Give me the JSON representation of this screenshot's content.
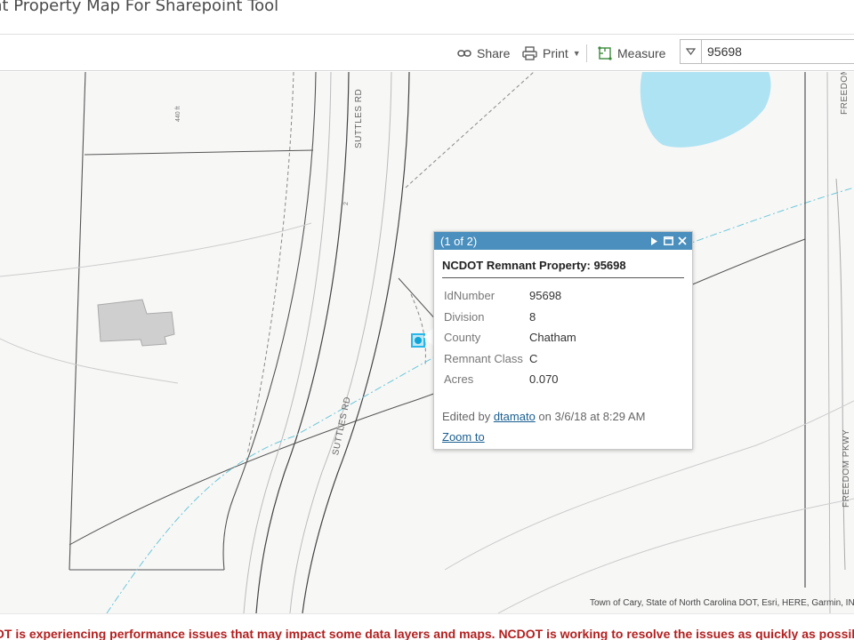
{
  "app": {
    "title": "nt Property Map For Sharepoint Tool"
  },
  "toolbar": {
    "share_label": "Share",
    "print_label": "Print",
    "measure_label": "Measure",
    "search_value": "95698"
  },
  "map": {
    "road_labels": {
      "suttles_top": "SUTTLES RD",
      "suttles_bottom": "SUTTLES RD",
      "freedom_top": "FREEDOM",
      "freedom_bottom": "FREEDOM PKWY"
    },
    "small_labels": {
      "dimension": "440 ft",
      "lot": "2"
    },
    "attribution": "Town of Cary, State of North Carolina DOT, Esri, HERE, Garmin, INCREMENT P, NGA, USGS"
  },
  "popup": {
    "counter": "(1 of 2)",
    "title": "NCDOT Remnant Property: 95698",
    "fields": [
      {
        "key": "IdNumber",
        "value": "95698"
      },
      {
        "key": "Division",
        "value": "8"
      },
      {
        "key": "County",
        "value": "Chatham"
      },
      {
        "key": "Remnant Class",
        "value": "C"
      },
      {
        "key": "Acres",
        "value": "0.070"
      }
    ],
    "edited_prefix": "Edited by ",
    "edited_user": "dtamato",
    "edited_suffix": " on 3/6/18 at 8:29 AM",
    "zoom_label": "Zoom to"
  },
  "banner": {
    "text": "OT is experiencing performance issues that may impact some data layers and maps. NCDOT is working to resolve the issues as quickly as possible."
  },
  "colors": {
    "popup_header": "#4a8fbd",
    "banner_text": "#b32020",
    "water": "#aee3f3",
    "selection": "#29b6e8"
  }
}
